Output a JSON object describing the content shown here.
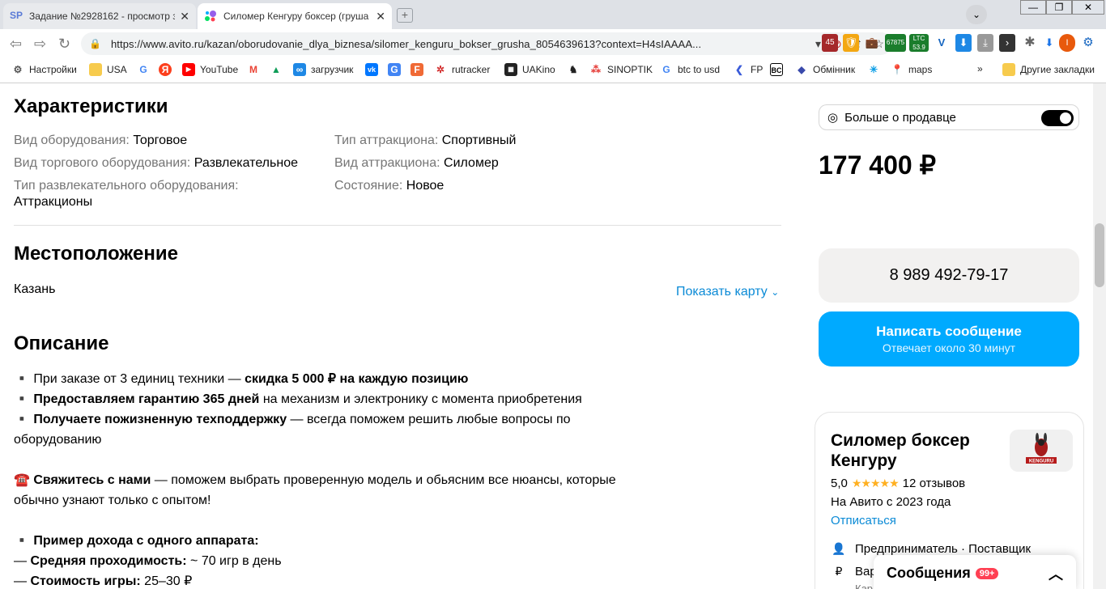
{
  "browser": {
    "tabs": [
      {
        "favicon": "SP",
        "title": "Задание №2928162 - просмотр з",
        "close": "✕"
      },
      {
        "favicon": "avito-logo-icon",
        "title": "Силомер Кенгуру боксер (груша",
        "close": "✕"
      }
    ],
    "new_tab": "+",
    "window": {
      "minimize": "—",
      "maximize": "❐",
      "close": "✕"
    },
    "address_url": "https://www.avito.ru/kazan/oborudovanie_dlya_biznesa/silomer_kenguru_bokser_grusha_8054639613?context=H4sIAAAA...",
    "ext_badges": {
      "e1": "45",
      "e2": "67875",
      "e3": "LTC",
      "e4": "53.9"
    },
    "profile_letter": "I"
  },
  "bookmarks": [
    {
      "label": "Настройки",
      "icon": "gear-icon"
    },
    {
      "label": "USA",
      "icon": "folder-icon"
    },
    {
      "label": "",
      "icon": "google-icon"
    },
    {
      "label": "",
      "icon": "yandex-icon"
    },
    {
      "label": "YouTube",
      "icon": "youtube-icon"
    },
    {
      "label": "",
      "icon": "gmail-icon"
    },
    {
      "label": "",
      "icon": "drive-icon"
    },
    {
      "label": "загрузчик",
      "icon": "downloader-icon"
    },
    {
      "label": "",
      "icon": "vk-icon"
    },
    {
      "label": "",
      "icon": "translate-icon"
    },
    {
      "label": "",
      "icon": "f-icon"
    },
    {
      "label": "rutracker",
      "icon": "rutracker-icon"
    },
    {
      "label": "UAKino",
      "icon": "uakino-icon"
    },
    {
      "label": "",
      "icon": "chess-icon"
    },
    {
      "label": "SINOPTIK",
      "icon": "sinoptik-icon"
    },
    {
      "label": "btc to usd",
      "icon": "google-icon"
    },
    {
      "label": "FP",
      "icon": "fp-icon"
    },
    {
      "label": "",
      "icon": "bc-icon"
    },
    {
      "label": "Обмінник",
      "icon": "exchange-icon"
    },
    {
      "label": "",
      "icon": "star-icon"
    },
    {
      "label": "maps",
      "icon": "maps-icon"
    }
  ],
  "bookmarks_more": "»",
  "bookmarks_other": "Другие закладки",
  "page": {
    "characteristics": {
      "heading": "Характеристики",
      "left": [
        {
          "key": "Вид оборудования:",
          "val": "Торговое"
        },
        {
          "key": "Вид торгового оборудования:",
          "val": "Развлекательное"
        },
        {
          "key": "Тип развлекательного оборудования:",
          "val": "Аттракционы"
        }
      ],
      "right": [
        {
          "key": "Тип аттракциона:",
          "val": "Спортивный"
        },
        {
          "key": "Вид аттракциона:",
          "val": "Силомер"
        },
        {
          "key": "Состояние:",
          "val": "Новое"
        }
      ]
    },
    "location": {
      "heading": "Местоположение",
      "city": "Казань",
      "show_map": "Показать карту"
    },
    "description": {
      "heading": "Описание",
      "l1_pre": "▪️ При заказе от 3 единиц техники — ",
      "l1_bold": "скидка 5 000 ₽ на каждую позицию",
      "l2_pre": "▪️ ",
      "l2_bold": "Предоставляем гарантию 365 дней",
      "l2_post": " на механизм и электронику с момента приобретения",
      "l3_pre": "▪️ ",
      "l3_bold": "Получаете пожизненную техподдержку",
      "l3_post": " — всегда поможем решить любые вопросы по оборудованию",
      "l4_pre": "☎️ ",
      "l4_bold": "Свяжитесь с нами",
      "l4_post": " — поможем выбрать проверенную модель и обьясним все нюансы, которые обычно узнают только с опытом!",
      "l5_pre": "▪️ ",
      "l5_bold": "Пример дохода с одного аппарата:",
      "l6_pre": "— ",
      "l6_bold": "Средняя проходимость:",
      "l6_post": " ~ 70 игр в день",
      "l7_pre": "— ",
      "l7_bold": "Стоимость игры:",
      "l7_post": " 25–30 ₽"
    },
    "sidebar": {
      "more_about_seller": "Больше о продавце",
      "price": "177 400 ₽",
      "phone": "8 989 492-79-17",
      "write_message": "Написать сообщение",
      "response_time": "Отвечает около 30 минут",
      "seller_name": "Силомер боксер Кенгуру",
      "rating": "5,0",
      "stars": "★★★★★",
      "reviews": "12 отзывов",
      "on_avito_since": "На Авито с 2023 года",
      "unsubscribe": "Отписаться",
      "seller_type": "Предприниматель · Поставщик",
      "row2": "Вар",
      "row3": "Кар",
      "logo_text": "KENGURU"
    },
    "messages_widget": {
      "label": "Сообщения",
      "badge": "99+"
    }
  },
  "colors": {
    "accent": "#00aaff",
    "link": "#0a8ad6",
    "star": "#ffb021",
    "badge": "#ff4053"
  }
}
